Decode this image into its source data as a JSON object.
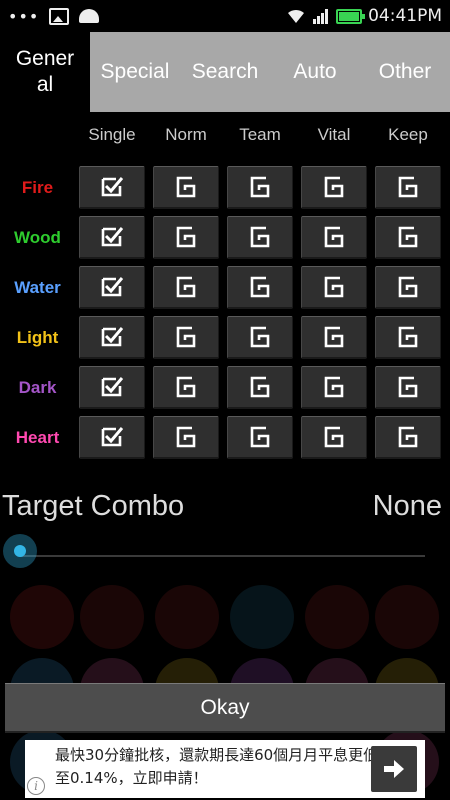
{
  "status_bar": {
    "time": "04:41PM",
    "icons": [
      "overflow-dots-icon",
      "image-icon",
      "android-icon",
      "wifi-icon",
      "signal-icon",
      "battery-icon"
    ]
  },
  "tabs": [
    {
      "label": "General",
      "active": true
    },
    {
      "label": "Special",
      "active": false
    },
    {
      "label": "Search",
      "active": false
    },
    {
      "label": "Auto",
      "active": false
    },
    {
      "label": "Other",
      "active": false
    }
  ],
  "columns": [
    "Single",
    "Norm",
    "Team",
    "Vital",
    "Keep"
  ],
  "rows": [
    {
      "label": "Fire",
      "color": "#e01b1b",
      "states": [
        true,
        false,
        false,
        false,
        false
      ]
    },
    {
      "label": "Wood",
      "color": "#2ecc2e",
      "states": [
        true,
        false,
        false,
        false,
        false
      ]
    },
    {
      "label": "Water",
      "color": "#5aa0ff",
      "states": [
        true,
        false,
        false,
        false,
        false
      ]
    },
    {
      "label": "Light",
      "color": "#f2c218",
      "states": [
        true,
        false,
        false,
        false,
        false
      ]
    },
    {
      "label": "Dark",
      "color": "#a455c8",
      "states": [
        true,
        false,
        false,
        false,
        false
      ]
    },
    {
      "label": "Heart",
      "color": "#ff49b0",
      "states": [
        true,
        false,
        false,
        false,
        false
      ]
    }
  ],
  "target_combo": {
    "label": "Target Combo",
    "value": "None"
  },
  "okay_label": "Okay",
  "ad": {
    "text": "最快30分鐘批核，還款期長達60個月月平息更低至0.14%，立即申請！"
  },
  "colors": {
    "accent": "#33b5e5",
    "tab_inactive": "#a8a8a8",
    "cell_bg": "#2f2f2f"
  }
}
